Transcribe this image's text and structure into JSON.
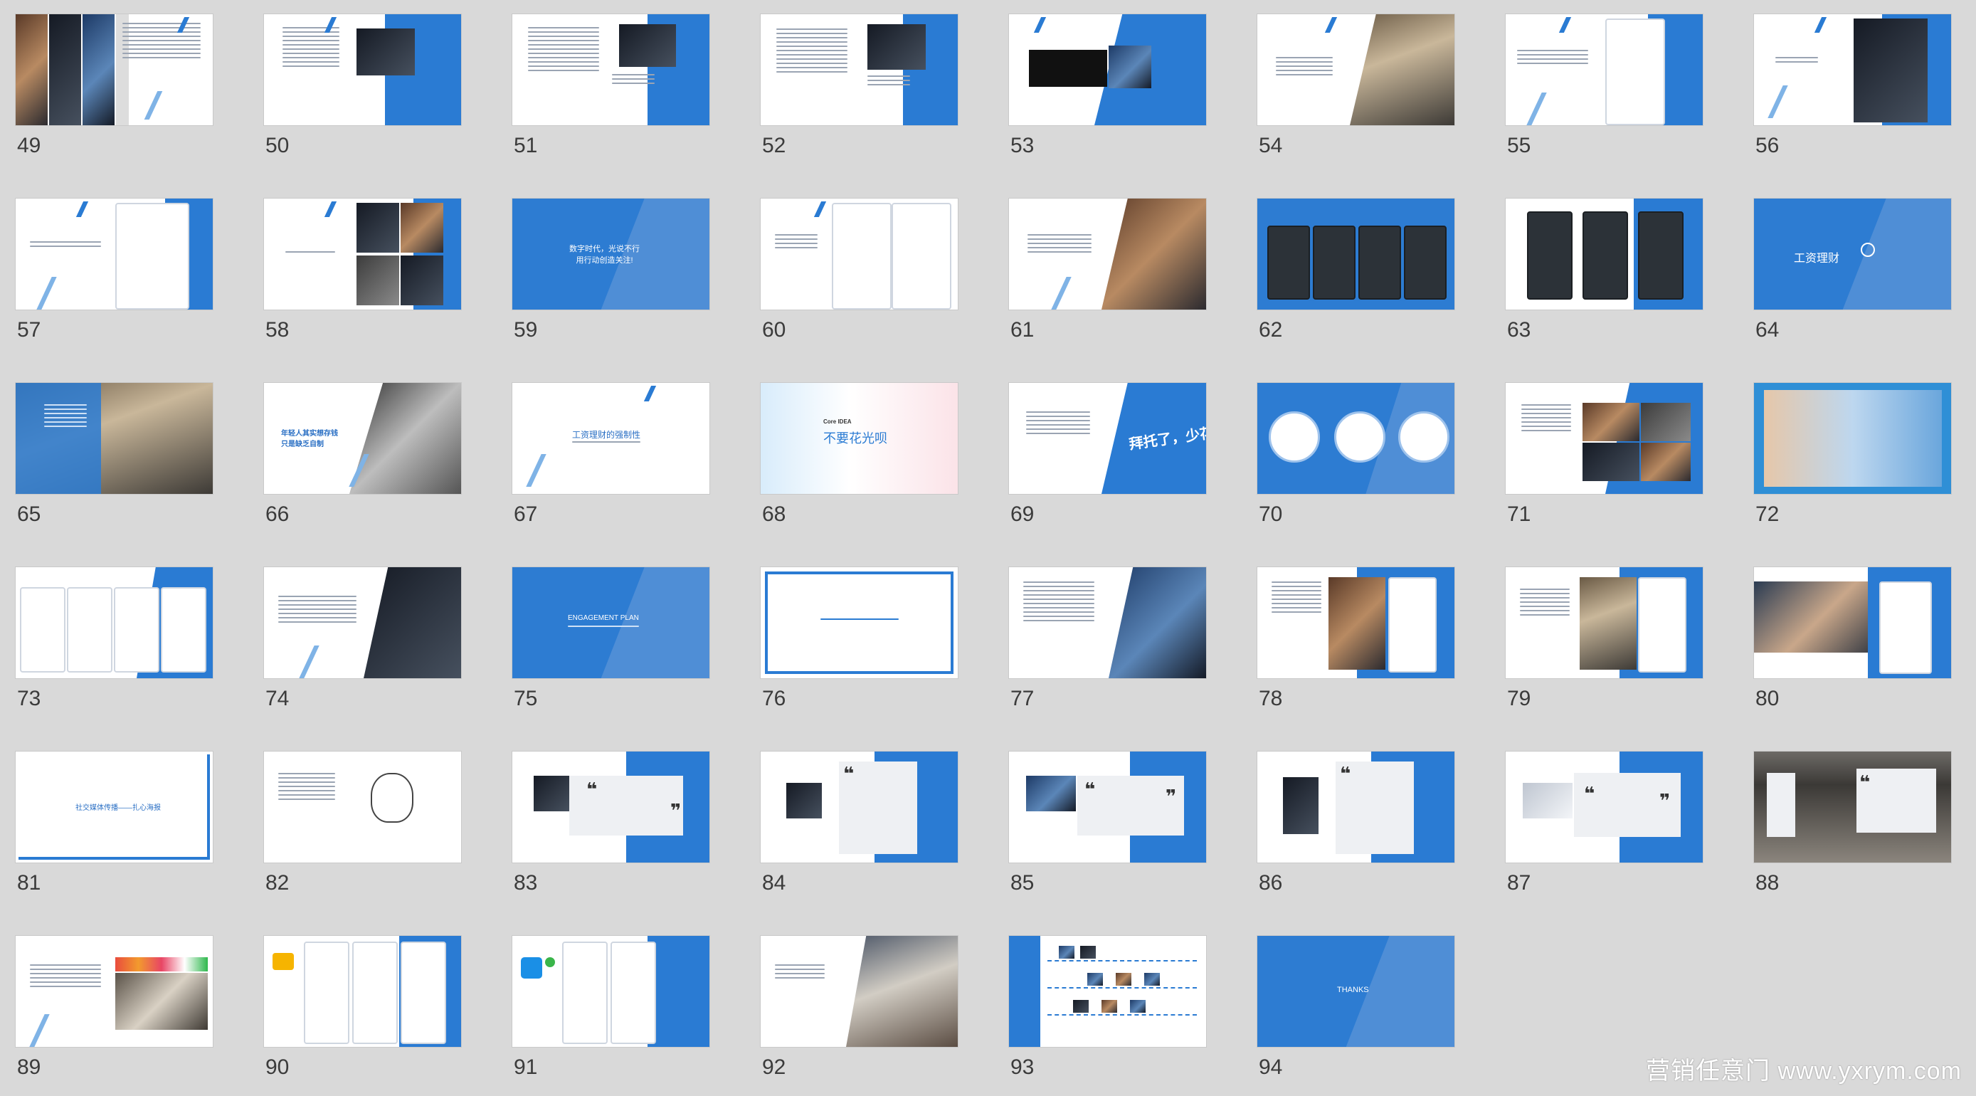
{
  "watermark": "营销任意门 www.yxrym.com",
  "slides": [
    {
      "num": "49"
    },
    {
      "num": "50"
    },
    {
      "num": "51"
    },
    {
      "num": "52"
    },
    {
      "num": "53"
    },
    {
      "num": "54"
    },
    {
      "num": "55"
    },
    {
      "num": "56"
    },
    {
      "num": "57"
    },
    {
      "num": "58"
    },
    {
      "num": "59",
      "text": "数字时代，光说不行\n用行动创造关注!"
    },
    {
      "num": "60"
    },
    {
      "num": "61"
    },
    {
      "num": "62"
    },
    {
      "num": "63"
    },
    {
      "num": "64",
      "text": "工资理财"
    },
    {
      "num": "65"
    },
    {
      "num": "66",
      "text": "年轻人其实想存钱\n只是缺乏自制"
    },
    {
      "num": "67",
      "text": "工资理财的强制性"
    },
    {
      "num": "68",
      "text": "不要花光呗",
      "small": "Core IDEA"
    },
    {
      "num": "69",
      "text": "拜托了，少花点!"
    },
    {
      "num": "70"
    },
    {
      "num": "71"
    },
    {
      "num": "72"
    },
    {
      "num": "73"
    },
    {
      "num": "74"
    },
    {
      "num": "75",
      "text": "ENGAGEMENT PLAN"
    },
    {
      "num": "76"
    },
    {
      "num": "77"
    },
    {
      "num": "78"
    },
    {
      "num": "79"
    },
    {
      "num": "80"
    },
    {
      "num": "81",
      "text": "社交媒体传播——扎心海报"
    },
    {
      "num": "82"
    },
    {
      "num": "83"
    },
    {
      "num": "84"
    },
    {
      "num": "85"
    },
    {
      "num": "86"
    },
    {
      "num": "87"
    },
    {
      "num": "88"
    },
    {
      "num": "89"
    },
    {
      "num": "90"
    },
    {
      "num": "91"
    },
    {
      "num": "92"
    },
    {
      "num": "93"
    },
    {
      "num": "94",
      "text": "THANKS"
    }
  ]
}
